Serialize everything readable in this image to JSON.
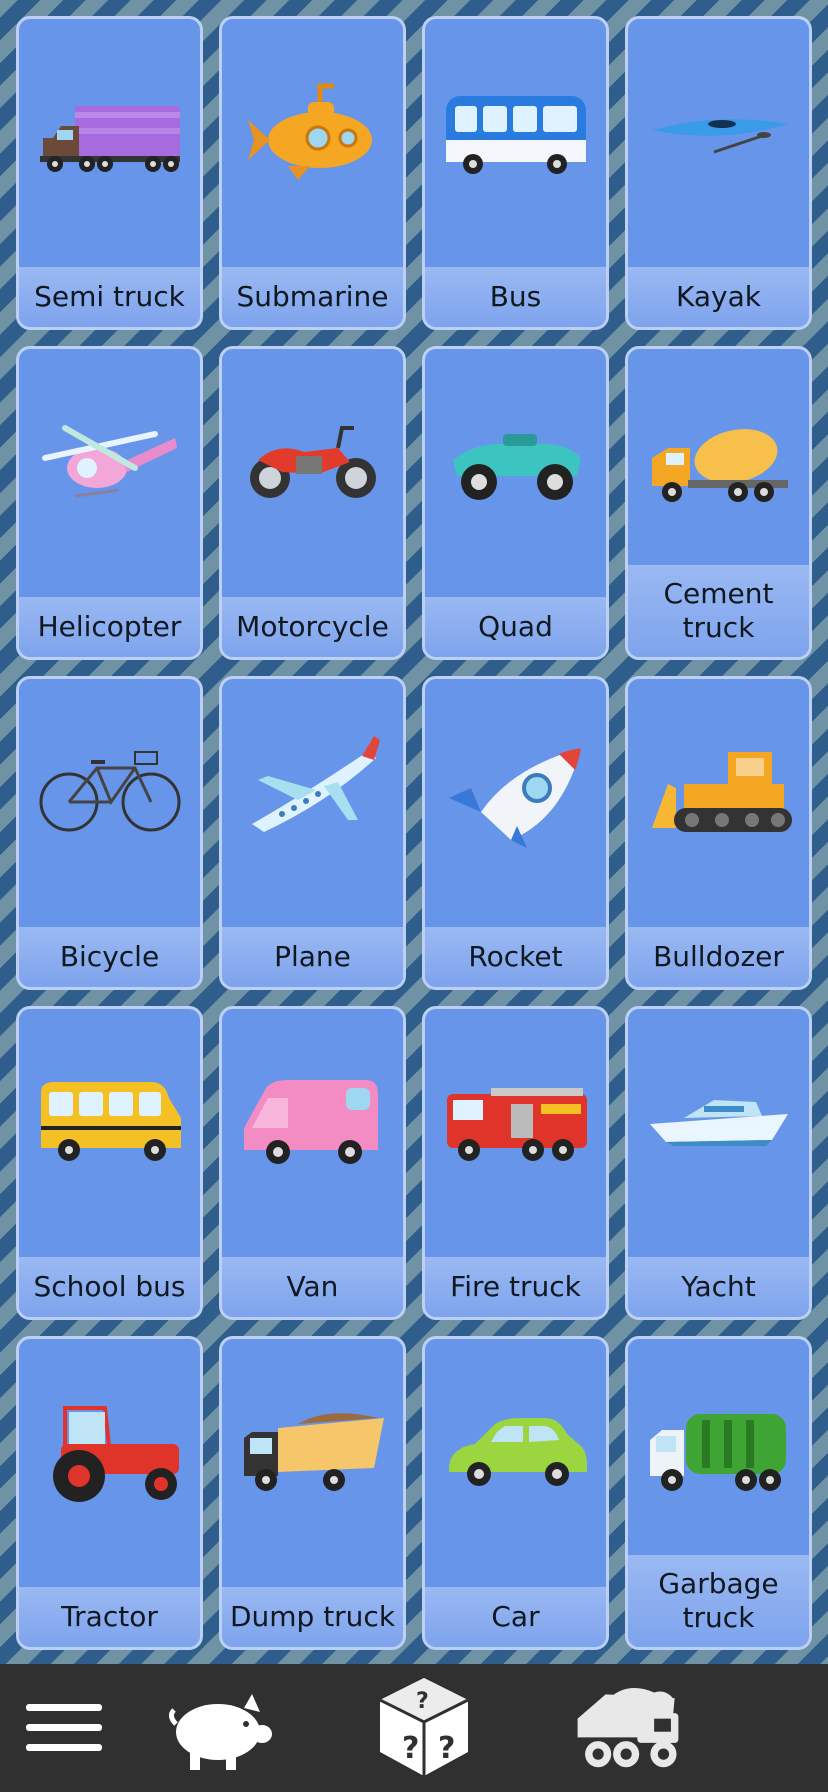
{
  "cards": [
    {
      "label": "Semi truck",
      "icon": "semi-truck-icon"
    },
    {
      "label": "Submarine",
      "icon": "submarine-icon"
    },
    {
      "label": "Bus",
      "icon": "bus-icon"
    },
    {
      "label": "Kayak",
      "icon": "kayak-icon"
    },
    {
      "label": "Helicopter",
      "icon": "helicopter-icon"
    },
    {
      "label": "Motorcycle",
      "icon": "motorcycle-icon"
    },
    {
      "label": "Quad",
      "icon": "quad-icon"
    },
    {
      "label": "Cement truck",
      "icon": "cement-truck-icon"
    },
    {
      "label": "Bicycle",
      "icon": "bicycle-icon"
    },
    {
      "label": "Plane",
      "icon": "plane-icon"
    },
    {
      "label": "Rocket",
      "icon": "rocket-icon"
    },
    {
      "label": "Bulldozer",
      "icon": "bulldozer-icon"
    },
    {
      "label": "School bus",
      "icon": "school-bus-icon"
    },
    {
      "label": "Van",
      "icon": "van-icon"
    },
    {
      "label": "Fire truck",
      "icon": "fire-truck-icon"
    },
    {
      "label": "Yacht",
      "icon": "yacht-icon"
    },
    {
      "label": "Tractor",
      "icon": "tractor-icon"
    },
    {
      "label": "Dump truck",
      "icon": "dump-truck-icon"
    },
    {
      "label": "Car",
      "icon": "car-icon"
    },
    {
      "label": "Garbage truck",
      "icon": "garbage-truck-icon"
    }
  ],
  "bottom_nav": [
    {
      "name": "menu-button",
      "icon": "hamburger-menu-icon"
    },
    {
      "name": "farm-animals-button",
      "icon": "pig-icon"
    },
    {
      "name": "random-button",
      "icon": "question-dice-icon"
    },
    {
      "name": "vehicles-button",
      "icon": "dump-truck-icon"
    }
  ],
  "colors": {
    "card_background": "#6795ea",
    "card_border": "#bcd0f5",
    "nav_background": "#303030",
    "stripe_dark": "#2f5e8c",
    "stripe_light": "#6f93a5"
  }
}
